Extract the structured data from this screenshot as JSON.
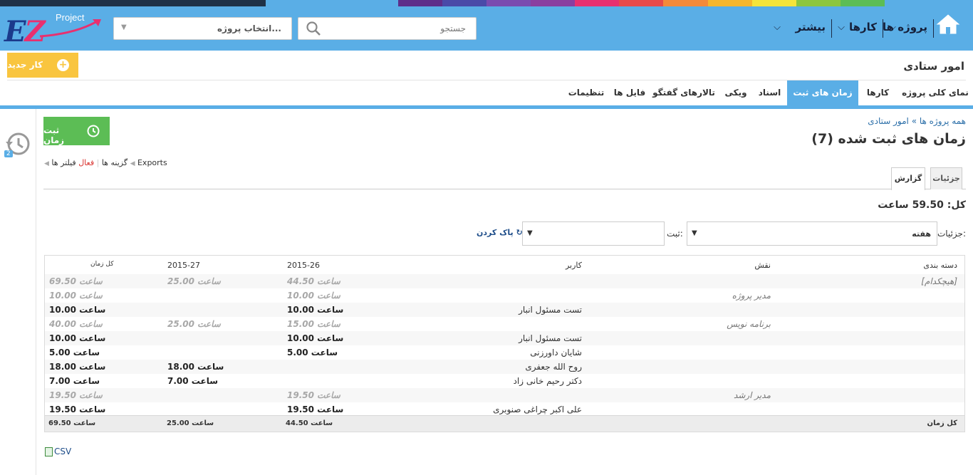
{
  "strip_colors": [
    "#1f3147",
    "#1f3147",
    "#1f3147",
    "#1f3147",
    "#1f3147",
    "#1f3147",
    "#5aaee6",
    "#5aaee6",
    "#5aaee6",
    "#5e2e8a",
    "#4a4aa8",
    "#7a4bb0",
    "#8a3ea0",
    "#e8306f",
    "#e84a4a",
    "#f48a3a",
    "#f6b62c",
    "#f5e43a",
    "#8cc63f",
    "#5cbd55",
    "#5aaee6",
    "#5aaee6"
  ],
  "header": {
    "logo_ez": "EZ",
    "logo_project": "Project",
    "project_select_placeholder": "انتخاب پروژه...",
    "search_placeholder": "جستجو",
    "nav": {
      "projects": "پروژه ها",
      "tasks": "کارها",
      "more": "بیشتر"
    }
  },
  "project": {
    "title": "امور ستادی",
    "new_task": "کار جدید"
  },
  "tabs": [
    {
      "label": "نمای کلی پروژه",
      "active": false
    },
    {
      "label": "کارها",
      "active": false
    },
    {
      "label": "زمان های ثبت شده",
      "active": true
    },
    {
      "label": "اسناد",
      "active": false
    },
    {
      "label": "ویکی",
      "active": false
    },
    {
      "label": "تالارهای گفتگو",
      "active": false
    },
    {
      "label": "فایل ها",
      "active": false
    },
    {
      "label": "تنظیمات",
      "active": false
    }
  ],
  "sidebar": {
    "history_count": "2"
  },
  "main": {
    "log_time": "ثبت زمان",
    "breadcrumb": "همه پروژه ها » امور ستادی",
    "title": "زمان های ثبت شده (7)",
    "options": {
      "exports": "Exports",
      "filters": "فیلتر ها",
      "active": "فعال",
      "options": "گزینه ها"
    },
    "subtabs": {
      "details": "جزئیات",
      "report": "گزارش"
    },
    "total": "کل: 59.50 ساعت",
    "filters": {
      "details_label": "جزئیات:",
      "details_value": "هفته",
      "add_label": "ثبت:",
      "clear": "پاک کردن"
    }
  },
  "report": {
    "headers": {
      "category": "دسته بندی",
      "role": "نقش",
      "user": "کاربر",
      "w26": "2015-26",
      "w27": "2015-27",
      "total": "کل زمان"
    },
    "rows": [
      {
        "type": "grp",
        "category": "[هیچکدام]",
        "role": "",
        "user": "",
        "w26": "44.50 ساعت",
        "w27": "25.00 ساعت",
        "total": "69.50 ساعت"
      },
      {
        "type": "grp",
        "category": "",
        "role": "مدیر پروژه",
        "user": "",
        "w26": "10.00 ساعت",
        "w27": "",
        "total": "10.00 ساعت"
      },
      {
        "type": "usr",
        "category": "",
        "role": "",
        "user": "تست مسئول انبار",
        "w26": "10.00 ساعت",
        "w27": "",
        "total": "10.00 ساعت"
      },
      {
        "type": "grp",
        "category": "",
        "role": "برنامه نویس",
        "user": "",
        "w26": "15.00 ساعت",
        "w27": "25.00 ساعت",
        "total": "40.00 ساعت"
      },
      {
        "type": "usr",
        "category": "",
        "role": "",
        "user": "تست مسئول انبار",
        "w26": "10.00 ساعت",
        "w27": "",
        "total": "10.00 ساعت"
      },
      {
        "type": "usr",
        "category": "",
        "role": "",
        "user": "شایان داورزنی",
        "w26": "5.00 ساعت",
        "w27": "",
        "total": "5.00 ساعت"
      },
      {
        "type": "usr",
        "category": "",
        "role": "",
        "user": "روح الله جعفری",
        "w26": "",
        "w27": "18.00 ساعت",
        "total": "18.00 ساعت"
      },
      {
        "type": "usr",
        "category": "",
        "role": "",
        "user": "دکتر رحیم خانی زاد",
        "w26": "",
        "w27": "7.00 ساعت",
        "total": "7.00 ساعت"
      },
      {
        "type": "grp",
        "category": "",
        "role": "مدیر ارشد",
        "user": "",
        "w26": "19.50 ساعت",
        "w27": "",
        "total": "19.50 ساعت"
      },
      {
        "type": "usr",
        "category": "",
        "role": "",
        "user": "علی اکبر چراغی صنوبری",
        "w26": "19.50 ساعت",
        "w27": "",
        "total": "19.50 ساعت"
      }
    ],
    "footer": {
      "label": "کل زمان",
      "w26": "44.50 ساعت",
      "w27": "25.00 ساعت",
      "total": "69.50 ساعت"
    }
  },
  "csv": "CSV"
}
